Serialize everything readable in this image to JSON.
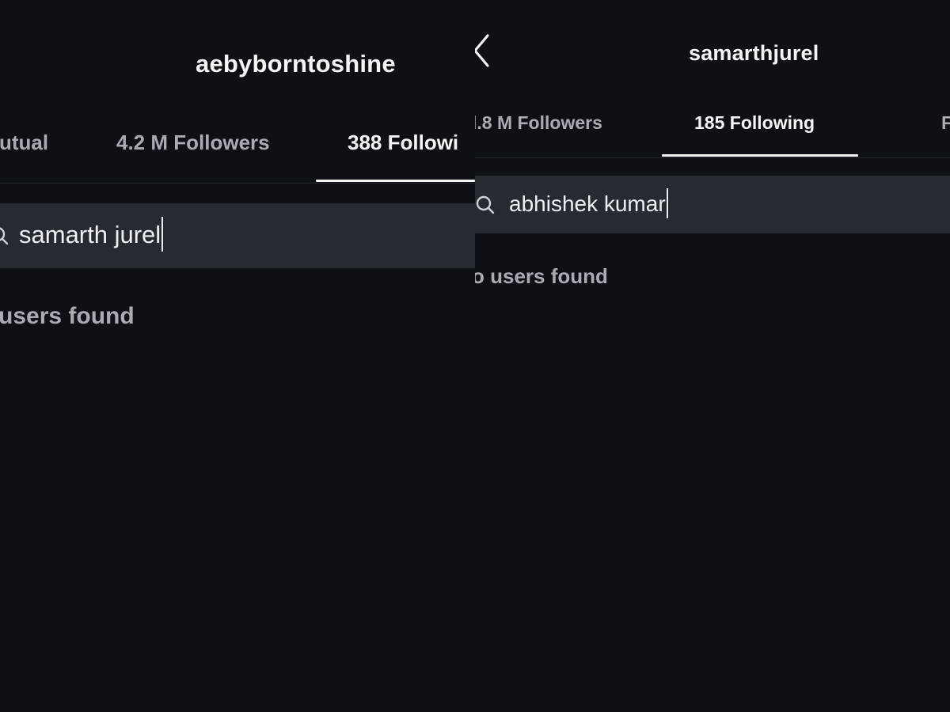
{
  "left_panel": {
    "header": {
      "username": "aebyborntoshine"
    },
    "tabs": [
      {
        "label": "utual",
        "active": false
      },
      {
        "label": "4.2 M Followers",
        "active": false
      },
      {
        "label": "388 Followi",
        "active": true
      }
    ],
    "search": {
      "value": "samarth jurel"
    },
    "result": {
      "message": "users found"
    }
  },
  "right_panel": {
    "header": {
      "username": "samarthjurel",
      "back_icon": "chevron-left-icon"
    },
    "tabs": [
      {
        "label": "l.8 M Followers",
        "active": false
      },
      {
        "label": "185 Following",
        "active": true
      },
      {
        "label": "F",
        "active": false
      }
    ],
    "search": {
      "value": "abhishek kumar",
      "icon": "search-icon"
    },
    "result": {
      "message": "o users found"
    }
  },
  "colors": {
    "background": "#0d1015",
    "search_bg": "#262a31",
    "text_primary": "#f4f5f7",
    "text_secondary": "#a9acb3"
  }
}
